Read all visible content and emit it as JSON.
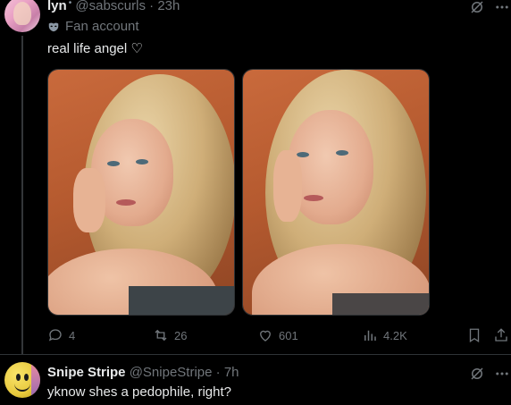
{
  "tweet": {
    "author_name": "lyn",
    "author_badge": "•",
    "author_handle": "@sabscurls",
    "separator": "·",
    "time": "23h",
    "account_label": "Fan account",
    "text": "real life angel ♡",
    "images": [
      {
        "name": "photo-1"
      },
      {
        "name": "photo-2"
      }
    ],
    "actions": {
      "replies": "4",
      "retweets": "26",
      "likes": "601",
      "views": "4.2K"
    }
  },
  "reply": {
    "author_name": "Snipe Stripe",
    "author_handle": "@SnipeStripe",
    "separator": "·",
    "time": "7h",
    "text": "yknow shes a pedophile, right?"
  },
  "colors": {
    "background": "#000000",
    "text_primary": "#e7e9ea",
    "text_muted": "#71767b",
    "divider": "#2f3336"
  }
}
